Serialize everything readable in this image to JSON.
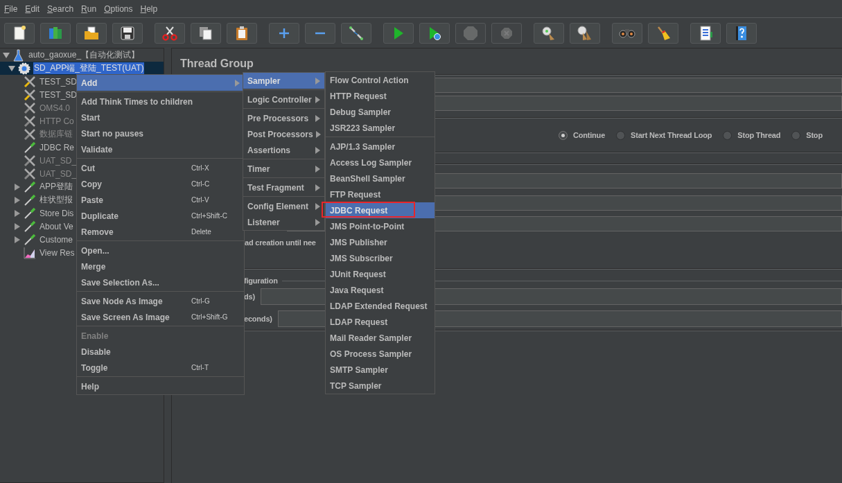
{
  "menu_bar": [
    "File",
    "Edit",
    "Search",
    "Run",
    "Options",
    "Help"
  ],
  "toolbar": [
    [
      {
        "kind": "new",
        "disabled": false
      },
      {
        "kind": "templates",
        "disabled": false
      },
      {
        "kind": "open",
        "disabled": false
      },
      {
        "kind": "save",
        "disabled": false
      }
    ],
    [
      {
        "kind": "cut",
        "disabled": false
      },
      {
        "kind": "copy",
        "disabled": false
      },
      {
        "kind": "paste",
        "disabled": false
      }
    ],
    [
      {
        "kind": "expand",
        "disabled": false
      },
      {
        "kind": "collapse",
        "disabled": false
      },
      {
        "kind": "toggle",
        "disabled": false
      }
    ],
    [
      {
        "kind": "start",
        "disabled": false
      },
      {
        "kind": "start-no-pauses",
        "disabled": false
      },
      {
        "kind": "stop",
        "disabled": true
      },
      {
        "kind": "shutdown",
        "disabled": true
      }
    ],
    [
      {
        "kind": "clear",
        "disabled": false
      },
      {
        "kind": "clear-all",
        "disabled": false
      }
    ],
    [
      {
        "kind": "search",
        "disabled": false
      },
      {
        "kind": "reset-search",
        "disabled": false
      }
    ],
    [
      {
        "kind": "function-helper",
        "disabled": false
      },
      {
        "kind": "help",
        "disabled": false
      }
    ]
  ],
  "tree": {
    "label": "auto_gaoxue_【自动化测试】",
    "kind": "test-plan",
    "expanded": true,
    "selected": false,
    "disabled": false,
    "children": [
      {
        "label": "SD_APP端_登陆_TEST(UAT)",
        "kind": "thread-group",
        "expanded": true,
        "selected": true,
        "disabled": false,
        "children": [
          {
            "label": "TEST_SD",
            "kind": "config",
            "selected": false,
            "disabled": false
          },
          {
            "label": "TEST_SD",
            "kind": "config",
            "selected": false,
            "disabled": false
          },
          {
            "label": "OMS4.0",
            "kind": "config",
            "selected": false,
            "disabled": true
          },
          {
            "label": "HTTP Co",
            "kind": "config",
            "selected": false,
            "disabled": true
          },
          {
            "label": "数据库链",
            "kind": "config",
            "selected": false,
            "disabled": true
          },
          {
            "label": "JDBC Re",
            "kind": "sampler",
            "selected": false,
            "disabled": false
          },
          {
            "label": "UAT_SD_",
            "kind": "config",
            "selected": false,
            "disabled": true
          },
          {
            "label": "UAT_SD_",
            "kind": "config",
            "selected": false,
            "disabled": true
          },
          {
            "label": "APP登陆",
            "kind": "sampler",
            "expanded": false,
            "selected": false,
            "disabled": false
          },
          {
            "label": "柱状型报",
            "kind": "sampler",
            "expanded": false,
            "selected": false,
            "disabled": false
          },
          {
            "label": "Store Dis",
            "kind": "sampler",
            "expanded": false,
            "selected": false,
            "disabled": false
          },
          {
            "label": "About Ve",
            "kind": "sampler",
            "expanded": false,
            "selected": false,
            "disabled": false
          },
          {
            "label": "Custome",
            "kind": "sampler",
            "expanded": false,
            "selected": false,
            "disabled": false
          },
          {
            "label": "View Res",
            "kind": "listener",
            "selected": false,
            "disabled": false
          }
        ]
      }
    ]
  },
  "panel": {
    "title": "Thread Group",
    "on_error_options": [
      {
        "label": "Continue",
        "selected": true
      },
      {
        "label": "Start Next Thread Loop",
        "selected": false
      },
      {
        "label": "Stop Thread",
        "selected": false
      },
      {
        "label": "Stop",
        "selected": false
      }
    ],
    "delay_creation_label": "ad creation until nee",
    "scheduler_legend": "figuration",
    "duration_label": "ds)",
    "startup_delay_label": "econds)"
  },
  "context_menu": {
    "groups": [
      [
        {
          "label": "Add",
          "selected": true,
          "disabled": false,
          "submenu": true
        }
      ],
      [
        {
          "label": "Add Think Times to children",
          "selected": false,
          "disabled": false,
          "submenu": false
        },
        {
          "label": "Start",
          "selected": false,
          "disabled": false,
          "submenu": false
        },
        {
          "label": "Start no pauses",
          "selected": false,
          "disabled": false,
          "submenu": false
        },
        {
          "label": "Validate",
          "selected": false,
          "disabled": false,
          "submenu": false
        }
      ],
      [
        {
          "label": "Cut",
          "shortcut": "Ctrl-X",
          "selected": false,
          "disabled": false,
          "submenu": false
        },
        {
          "label": "Copy",
          "shortcut": "Ctrl-C",
          "selected": false,
          "disabled": false,
          "submenu": false
        },
        {
          "label": "Paste",
          "shortcut": "Ctrl-V",
          "selected": false,
          "disabled": false,
          "submenu": false
        },
        {
          "label": "Duplicate",
          "shortcut": "Ctrl+Shift-C",
          "selected": false,
          "disabled": false,
          "submenu": false
        },
        {
          "label": "Remove",
          "shortcut": "Delete",
          "selected": false,
          "disabled": false,
          "submenu": false
        }
      ],
      [
        {
          "label": "Open...",
          "selected": false,
          "disabled": false,
          "submenu": false
        },
        {
          "label": "Merge",
          "selected": false,
          "disabled": false,
          "submenu": false
        },
        {
          "label": "Save Selection As...",
          "selected": false,
          "disabled": false,
          "submenu": false
        }
      ],
      [
        {
          "label": "Save Node As Image",
          "shortcut": "Ctrl-G",
          "selected": false,
          "disabled": false,
          "submenu": false
        },
        {
          "label": "Save Screen As Image",
          "shortcut": "Ctrl+Shift-G",
          "selected": false,
          "disabled": false,
          "submenu": false
        }
      ],
      [
        {
          "label": "Enable",
          "selected": false,
          "disabled": true,
          "submenu": false
        },
        {
          "label": "Disable",
          "selected": false,
          "disabled": false,
          "submenu": false
        },
        {
          "label": "Toggle",
          "shortcut": "Ctrl-T",
          "selected": false,
          "disabled": false,
          "submenu": false
        }
      ],
      [
        {
          "label": "Help",
          "selected": false,
          "disabled": false,
          "submenu": false
        }
      ]
    ]
  },
  "add_submenu": {
    "groups": [
      [
        {
          "label": "Sampler",
          "selected": true
        }
      ],
      [
        {
          "label": "Logic Controller",
          "selected": false
        }
      ],
      [
        {
          "label": "Pre Processors",
          "selected": false
        },
        {
          "label": "Post Processors",
          "selected": false
        },
        {
          "label": "Assertions",
          "selected": false
        }
      ],
      [
        {
          "label": "Timer",
          "selected": false
        }
      ],
      [
        {
          "label": "Test Fragment",
          "selected": false
        }
      ],
      [
        {
          "label": "Config Element",
          "selected": false
        },
        {
          "label": "Listener",
          "selected": false
        }
      ]
    ]
  },
  "sampler_submenu": {
    "groups": [
      [
        {
          "label": "Flow Control Action",
          "selected": false,
          "outlined": false
        },
        {
          "label": "HTTP Request",
          "selected": false,
          "outlined": false
        },
        {
          "label": "Debug Sampler",
          "selected": false,
          "outlined": false
        },
        {
          "label": "JSR223 Sampler",
          "selected": false,
          "outlined": false
        }
      ],
      [
        {
          "label": "AJP/1.3 Sampler",
          "selected": false,
          "outlined": false
        },
        {
          "label": "Access Log Sampler",
          "selected": false,
          "outlined": false
        },
        {
          "label": "BeanShell Sampler",
          "selected": false,
          "outlined": false
        },
        {
          "label": "FTP Request",
          "selected": false,
          "outlined": false
        },
        {
          "label": "JDBC Request",
          "selected": true,
          "outlined": true
        },
        {
          "label": "JMS Point-to-Point",
          "selected": false,
          "outlined": false
        },
        {
          "label": "JMS Publisher",
          "selected": false,
          "outlined": false
        },
        {
          "label": "JMS Subscriber",
          "selected": false,
          "outlined": false
        },
        {
          "label": "JUnit Request",
          "selected": false,
          "outlined": false
        },
        {
          "label": "Java Request",
          "selected": false,
          "outlined": false
        },
        {
          "label": "LDAP Extended Request",
          "selected": false,
          "outlined": false
        },
        {
          "label": "LDAP Request",
          "selected": false,
          "outlined": false
        },
        {
          "label": "Mail Reader Sampler",
          "selected": false,
          "outlined": false
        },
        {
          "label": "OS Process Sampler",
          "selected": false,
          "outlined": false
        },
        {
          "label": "SMTP Sampler",
          "selected": false,
          "outlined": false
        },
        {
          "label": "TCP Sampler",
          "selected": false,
          "outlined": false
        }
      ]
    ]
  }
}
